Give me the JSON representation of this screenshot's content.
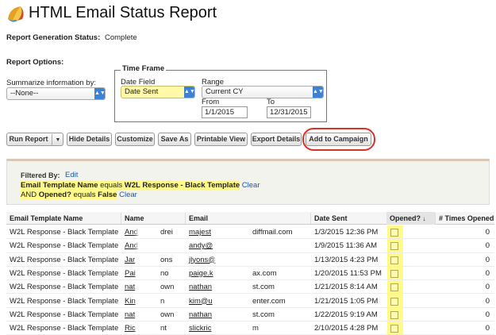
{
  "header": {
    "title": "HTML Email Status Report"
  },
  "status": {
    "label": "Report Generation Status:",
    "value": "Complete"
  },
  "options": {
    "label": "Report Options:",
    "summarize_label": "Summarize information by:",
    "summarize_value": "--None--"
  },
  "time_frame": {
    "legend": "Time Frame",
    "date_field_label": "Date Field",
    "date_field_value": "Date Sent",
    "range_label": "Range",
    "range_value": "Current CY",
    "from_label": "From",
    "from_value": "1/1/2015",
    "to_label": "To",
    "to_value": "12/31/2015"
  },
  "toolbar": {
    "run_report": "Run Report",
    "hide_details": "Hide Details",
    "customize": "Customize",
    "save_as": "Save As",
    "printable_view": "Printable View",
    "export_details": "Export Details",
    "add_to_campaign": "Add to Campaign"
  },
  "filters": {
    "label": "Filtered By:",
    "edit": "Edit",
    "f1_field": "Email Template Name",
    "f1_op": " equals ",
    "f1_value": "W2L Response - Black Template",
    "f2_prefix": "AND ",
    "f2_field": "Opened?",
    "f2_op": " equals ",
    "f2_value": "False",
    "clear": "Clear"
  },
  "table": {
    "columns": [
      "Email Template Name",
      "Name",
      "Email",
      "Date Sent",
      "Opened?",
      "# Times Opened"
    ],
    "sort_indicator": "↓",
    "rows": [
      {
        "template": "W2L Response - Black Template",
        "name_a": "And",
        "name_b": "drei",
        "email_a": "majest",
        "email_b": "diffmail.com",
        "date": "1/3/2015 12:36 PM",
        "times": "0"
      },
      {
        "template": "W2L Response - Black Template",
        "name_a": "And",
        "name_b": "",
        "email_a": "andy@",
        "email_b": "",
        "date": "1/9/2015 11:36 AM",
        "times": "0"
      },
      {
        "template": "W2L Response - Black Template",
        "name_a": "Jar",
        "name_b": "ons",
        "email_a": "jlyons@",
        "email_b": "",
        "date": "1/13/2015 4:23 PM",
        "times": "0"
      },
      {
        "template": "W2L Response - Black Template",
        "name_a": "Pai",
        "name_b": "no",
        "email_a": "paige.k",
        "email_b": "ax.com",
        "date": "1/20/2015 11:53 PM",
        "times": "0"
      },
      {
        "template": "W2L Response - Black Template",
        "name_a": "nat",
        "name_b": "own",
        "email_a": "nathan",
        "email_b": "st.com",
        "date": "1/21/2015 8:14 AM",
        "times": "0"
      },
      {
        "template": "W2L Response - Black Template",
        "name_a": "Kin",
        "name_b": "n",
        "email_a": "kim@u",
        "email_b": "enter.com",
        "date": "1/21/2015 1:05 PM",
        "times": "0"
      },
      {
        "template": "W2L Response - Black Template",
        "name_a": "nat",
        "name_b": "own",
        "email_a": "nathan",
        "email_b": "st.com",
        "date": "1/22/2015 9:19 AM",
        "times": "0"
      },
      {
        "template": "W2L Response - Black Template",
        "name_a": "Ric",
        "name_b": "nt",
        "email_a": "slickric",
        "email_b": "m",
        "date": "2/10/2015 4:28 PM",
        "times": "0"
      }
    ]
  },
  "colors": {
    "link": "#1a57b0",
    "highlight": "#fffa8a",
    "callout": "#d9302a",
    "select_accent": "#3b82d6"
  }
}
